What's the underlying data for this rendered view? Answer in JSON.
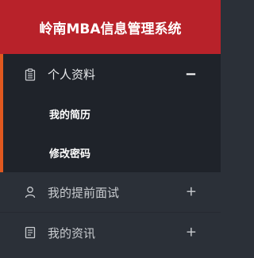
{
  "header": {
    "title": "岭南MBA信息管理系统"
  },
  "sidebar": {
    "groups": [
      {
        "label": "个人资料",
        "icon": "clipboard-icon",
        "toggle": "−",
        "expanded": true,
        "items": [
          {
            "label": "我的简历"
          },
          {
            "label": "修改密码"
          }
        ]
      },
      {
        "label": "我的提前面试",
        "icon": "user-icon",
        "toggle": "+",
        "expanded": false
      },
      {
        "label": "我的资讯",
        "icon": "document-icon",
        "toggle": "+",
        "expanded": false
      }
    ]
  },
  "colors": {
    "header_bg": "#b8222a",
    "sidebar_bg": "#2b3038",
    "active_group_bg": "#1f232a",
    "active_accent": "#e0581f"
  }
}
